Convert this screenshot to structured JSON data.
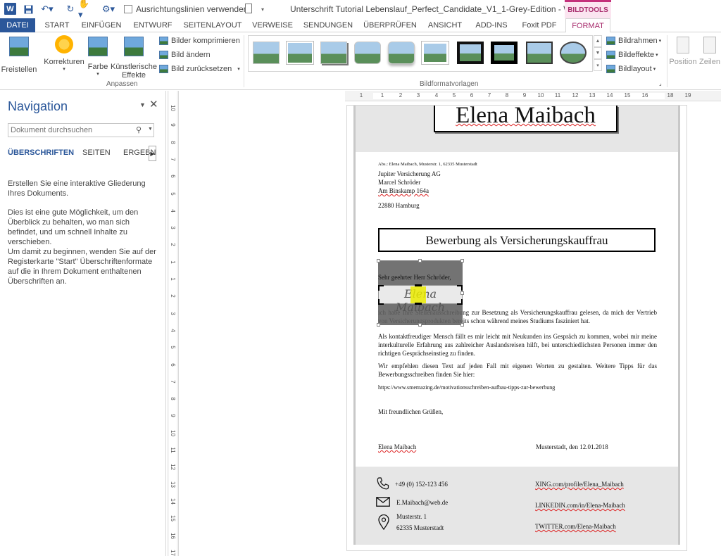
{
  "titlebar": {
    "app_logo": "W",
    "guides_label": "Ausrichtungslinien verwenden",
    "doc_title": "Unterschrift Tutorial Lebenslauf_Perfect_Candidate_V1_1-Grey-Edition - Word",
    "context_tab": "BILDTOOLS"
  },
  "tabs": [
    "DATEI",
    "START",
    "EINFÜGEN",
    "ENTWURF",
    "SEITENLAYOUT",
    "VERWEISE",
    "SENDUNGEN",
    "ÜBERPRÜFEN",
    "ANSICHT",
    "ADD-INS",
    "Foxit PDF",
    "FORMAT"
  ],
  "ribbon": {
    "freistellen": "Freistellen",
    "korrekturen": "Korrekturen",
    "farbe": "Farbe",
    "kuenstlerische_1": "Künstlerische",
    "kuenstlerische_2": "Effekte",
    "komprimieren": "Bilder komprimieren",
    "aendern": "Bild ändern",
    "zuruecksetzen": "Bild zurücksetzen",
    "group_anpassen": "Anpassen",
    "group_bildformat": "Bildformatvorlagen",
    "bildrahmen": "Bildrahmen",
    "bildeffekte": "Bildeffekte",
    "bildlayout": "Bildlayout",
    "position": "Position",
    "zeilenumbruch": "Zeilen"
  },
  "nav": {
    "title": "Navigation",
    "search_placeholder": "Dokument durchsuchen",
    "tab_headings": "ÜBERSCHRIFTEN",
    "tab_pages": "SEITEN",
    "tab_results": "ERGEBN",
    "p1": "Erstellen Sie eine interaktive Gliederung Ihres Dokuments.",
    "p2": "Dies ist eine gute Möglichkeit, um den Überblick zu behalten, wo man sich befindet, und um schnell Inhalte zu verschieben.",
    "p3": "Um damit zu beginnen, wenden Sie auf der Registerkarte \"Start\" Überschriftenformate auf die in Ihrem Dokument enthaltenen Überschriften an."
  },
  "ruler": {
    "h": [
      "1",
      "1",
      "2",
      "3",
      "4",
      "5",
      "6",
      "7",
      "8",
      "9",
      "10",
      "11",
      "12",
      "13",
      "14",
      "15",
      "16",
      "18",
      "19"
    ],
    "v": [
      "10",
      "9",
      "8",
      "7",
      "6",
      "5",
      "4",
      "3",
      "2",
      "1",
      "1",
      "2",
      "3",
      "4",
      "5",
      "6",
      "7",
      "8",
      "9",
      "10",
      "11",
      "12",
      "13",
      "14",
      "15",
      "16",
      "17"
    ]
  },
  "doc": {
    "name": "Elena Maibach",
    "sender_line": "Abs.: Elena Maibach, Musterstr. 1, 62335 Musterstadt",
    "recipient_1": "Jupiter Versicherung AG",
    "recipient_2": "Marcel Schröder",
    "recipient_3": "Am Binskamp 164a",
    "recipient_city": "22880 Hamburg",
    "subject": "Bewerbung als Versicherungskauffrau",
    "greeting": "Sehr geehrter Herr Schröder,",
    "signature_image": "Elena Maibach",
    "body_1": "ich habe Ihre Stellenausschreibung zur Besetzung als Versicherungskauffrau gelesen, da mich der Vertrieb von Versicherungsprodukten bereits schon während meines Studiums fasziniert hat.",
    "body_2": "Als kontaktfreudiger Mensch fällt es mir leicht mit Neukunden ins Gespräch zu kommen, wobei mir meine interkulturelle Erfahrung aus zahlreicher Auslandsreisen hilft, bei unterschiedlichsten Personen immer den richtigen Gesprächseinstieg zu finden.",
    "body_3": "Wir empfehlen diesen Text auf jeden Fall mit eigenen Worten zu gestalten. Weitere Tipps für das Bewerbungsschreiben finden Sie hier:",
    "link": "https://www.smemazing.de/motivationsschreiben-aufbau-tipps-zur-bewerbung",
    "closing": "Mit freundlichen Grüßen,",
    "sign_name": "Elena Maibach",
    "sign_place": "Musterstadt, den 12.01.2018",
    "phone": "+49 (0) 152-123 456",
    "email": "E.Maibach@web.de",
    "street": "Musterstr. 1",
    "city": "62335 Musterstadt",
    "xing": "XING.com/profile/Elena_Maibach",
    "linkedin": "LINKEDIN.com/in/Elena-Maibach",
    "twitter": "TWITTER.com/Elena-Maibach"
  },
  "colors": {
    "word_blue": "#2b579a",
    "bildtools_accent": "#a72b6c",
    "band_grey": "#e6e6e6"
  }
}
